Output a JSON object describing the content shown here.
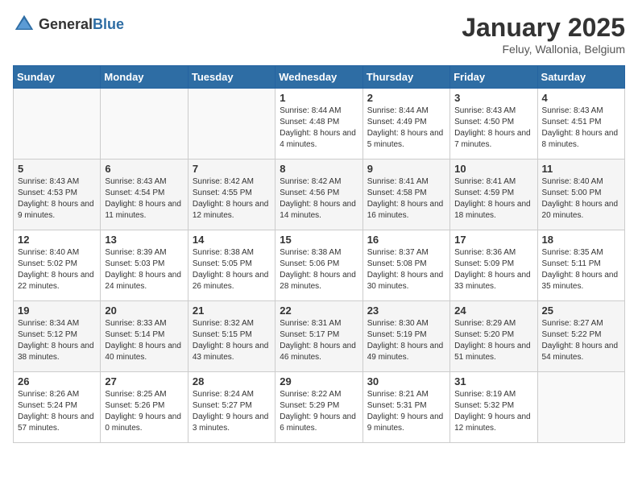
{
  "header": {
    "logo_general": "General",
    "logo_blue": "Blue",
    "month": "January 2025",
    "location": "Feluy, Wallonia, Belgium"
  },
  "weekdays": [
    "Sunday",
    "Monday",
    "Tuesday",
    "Wednesday",
    "Thursday",
    "Friday",
    "Saturday"
  ],
  "weeks": [
    [
      {
        "day": "",
        "info": ""
      },
      {
        "day": "",
        "info": ""
      },
      {
        "day": "",
        "info": ""
      },
      {
        "day": "1",
        "info": "Sunrise: 8:44 AM\nSunset: 4:48 PM\nDaylight: 8 hours and 4 minutes."
      },
      {
        "day": "2",
        "info": "Sunrise: 8:44 AM\nSunset: 4:49 PM\nDaylight: 8 hours and 5 minutes."
      },
      {
        "day": "3",
        "info": "Sunrise: 8:43 AM\nSunset: 4:50 PM\nDaylight: 8 hours and 7 minutes."
      },
      {
        "day": "4",
        "info": "Sunrise: 8:43 AM\nSunset: 4:51 PM\nDaylight: 8 hours and 8 minutes."
      }
    ],
    [
      {
        "day": "5",
        "info": "Sunrise: 8:43 AM\nSunset: 4:53 PM\nDaylight: 8 hours and 9 minutes."
      },
      {
        "day": "6",
        "info": "Sunrise: 8:43 AM\nSunset: 4:54 PM\nDaylight: 8 hours and 11 minutes."
      },
      {
        "day": "7",
        "info": "Sunrise: 8:42 AM\nSunset: 4:55 PM\nDaylight: 8 hours and 12 minutes."
      },
      {
        "day": "8",
        "info": "Sunrise: 8:42 AM\nSunset: 4:56 PM\nDaylight: 8 hours and 14 minutes."
      },
      {
        "day": "9",
        "info": "Sunrise: 8:41 AM\nSunset: 4:58 PM\nDaylight: 8 hours and 16 minutes."
      },
      {
        "day": "10",
        "info": "Sunrise: 8:41 AM\nSunset: 4:59 PM\nDaylight: 8 hours and 18 minutes."
      },
      {
        "day": "11",
        "info": "Sunrise: 8:40 AM\nSunset: 5:00 PM\nDaylight: 8 hours and 20 minutes."
      }
    ],
    [
      {
        "day": "12",
        "info": "Sunrise: 8:40 AM\nSunset: 5:02 PM\nDaylight: 8 hours and 22 minutes."
      },
      {
        "day": "13",
        "info": "Sunrise: 8:39 AM\nSunset: 5:03 PM\nDaylight: 8 hours and 24 minutes."
      },
      {
        "day": "14",
        "info": "Sunrise: 8:38 AM\nSunset: 5:05 PM\nDaylight: 8 hours and 26 minutes."
      },
      {
        "day": "15",
        "info": "Sunrise: 8:38 AM\nSunset: 5:06 PM\nDaylight: 8 hours and 28 minutes."
      },
      {
        "day": "16",
        "info": "Sunrise: 8:37 AM\nSunset: 5:08 PM\nDaylight: 8 hours and 30 minutes."
      },
      {
        "day": "17",
        "info": "Sunrise: 8:36 AM\nSunset: 5:09 PM\nDaylight: 8 hours and 33 minutes."
      },
      {
        "day": "18",
        "info": "Sunrise: 8:35 AM\nSunset: 5:11 PM\nDaylight: 8 hours and 35 minutes."
      }
    ],
    [
      {
        "day": "19",
        "info": "Sunrise: 8:34 AM\nSunset: 5:12 PM\nDaylight: 8 hours and 38 minutes."
      },
      {
        "day": "20",
        "info": "Sunrise: 8:33 AM\nSunset: 5:14 PM\nDaylight: 8 hours and 40 minutes."
      },
      {
        "day": "21",
        "info": "Sunrise: 8:32 AM\nSunset: 5:15 PM\nDaylight: 8 hours and 43 minutes."
      },
      {
        "day": "22",
        "info": "Sunrise: 8:31 AM\nSunset: 5:17 PM\nDaylight: 8 hours and 46 minutes."
      },
      {
        "day": "23",
        "info": "Sunrise: 8:30 AM\nSunset: 5:19 PM\nDaylight: 8 hours and 49 minutes."
      },
      {
        "day": "24",
        "info": "Sunrise: 8:29 AM\nSunset: 5:20 PM\nDaylight: 8 hours and 51 minutes."
      },
      {
        "day": "25",
        "info": "Sunrise: 8:27 AM\nSunset: 5:22 PM\nDaylight: 8 hours and 54 minutes."
      }
    ],
    [
      {
        "day": "26",
        "info": "Sunrise: 8:26 AM\nSunset: 5:24 PM\nDaylight: 8 hours and 57 minutes."
      },
      {
        "day": "27",
        "info": "Sunrise: 8:25 AM\nSunset: 5:26 PM\nDaylight: 9 hours and 0 minutes."
      },
      {
        "day": "28",
        "info": "Sunrise: 8:24 AM\nSunset: 5:27 PM\nDaylight: 9 hours and 3 minutes."
      },
      {
        "day": "29",
        "info": "Sunrise: 8:22 AM\nSunset: 5:29 PM\nDaylight: 9 hours and 6 minutes."
      },
      {
        "day": "30",
        "info": "Sunrise: 8:21 AM\nSunset: 5:31 PM\nDaylight: 9 hours and 9 minutes."
      },
      {
        "day": "31",
        "info": "Sunrise: 8:19 AM\nSunset: 5:32 PM\nDaylight: 9 hours and 12 minutes."
      },
      {
        "day": "",
        "info": ""
      }
    ]
  ]
}
